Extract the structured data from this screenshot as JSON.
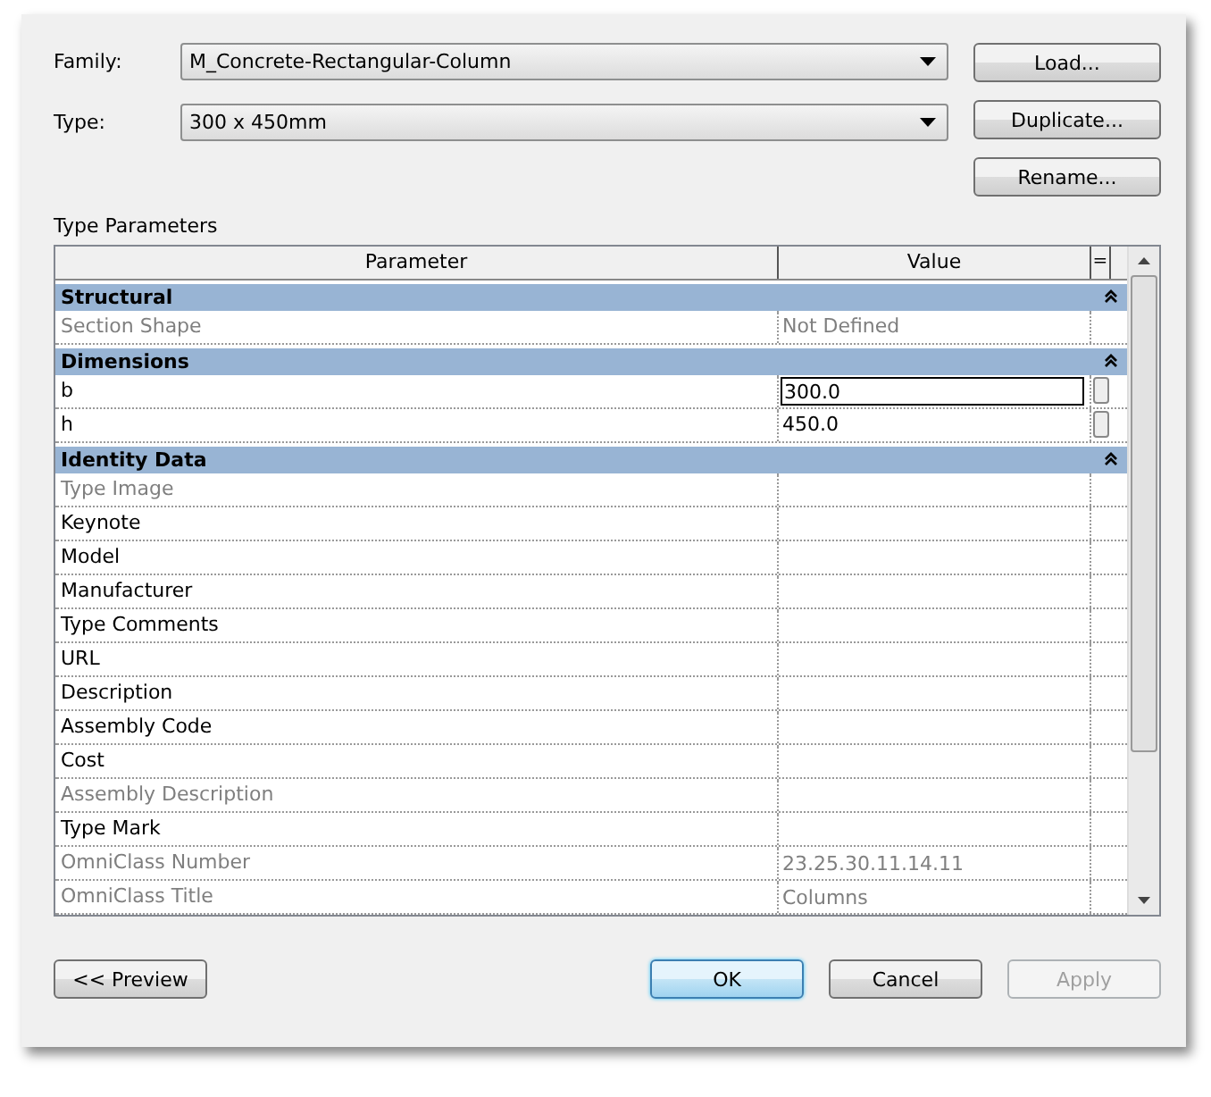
{
  "family": {
    "label": "Family:",
    "value": "M_Concrete-Rectangular-Column"
  },
  "type": {
    "label": "Type:",
    "value": "300 x 450mm"
  },
  "side_buttons": [
    "Load...",
    "Duplicate...",
    "Rename..."
  ],
  "section_title": "Type Parameters",
  "table": {
    "columns": [
      "Parameter",
      "Value",
      "="
    ],
    "groups": [
      {
        "name": "Structural",
        "expanded": true,
        "rows": [
          {
            "name": "Section Shape",
            "value": "Not Defined",
            "disabled": true,
            "editing": false,
            "spinner": false
          }
        ]
      },
      {
        "name": "Dimensions",
        "expanded": true,
        "rows": [
          {
            "name": "b",
            "value": "300.0",
            "disabled": false,
            "editing": true,
            "spinner": true
          },
          {
            "name": "h",
            "value": "450.0",
            "disabled": false,
            "editing": false,
            "spinner": true
          }
        ]
      },
      {
        "name": "Identity Data",
        "expanded": true,
        "rows": [
          {
            "name": "Type Image",
            "disabled": true,
            "editing": false,
            "spinner": false
          },
          {
            "name": "Keynote",
            "disabled": false,
            "editing": false,
            "spinner": false
          },
          {
            "name": "Model",
            "disabled": false,
            "editing": false,
            "spinner": false
          },
          {
            "name": "Manufacturer",
            "disabled": false,
            "editing": false,
            "spinner": false
          },
          {
            "name": "Type Comments",
            "disabled": false,
            "editing": false,
            "spinner": false
          },
          {
            "name": "URL",
            "disabled": false,
            "editing": false,
            "spinner": false
          },
          {
            "name": "Description",
            "disabled": false,
            "editing": false,
            "spinner": false
          },
          {
            "name": "Assembly Code",
            "disabled": false,
            "editing": false,
            "spinner": false
          },
          {
            "name": "Cost",
            "disabled": false,
            "editing": false,
            "spinner": false
          },
          {
            "name": "Assembly Description",
            "disabled": true,
            "editing": false,
            "spinner": false
          },
          {
            "name": "Type Mark",
            "disabled": false,
            "editing": false,
            "spinner": false
          },
          {
            "name": "OmniClass Number",
            "value": "23.25.30.11.14.11",
            "disabled": true,
            "editing": false,
            "spinner": false
          },
          {
            "name": "OmniClass Title",
            "value": "Columns",
            "disabled": true,
            "editing": false,
            "spinner": false
          }
        ]
      }
    ]
  },
  "bottom_buttons": [
    {
      "label": "<< Preview",
      "kind": "normal",
      "disabled": false
    },
    {
      "label": "OK",
      "kind": "default",
      "disabled": false
    },
    {
      "label": "Cancel",
      "kind": "normal",
      "disabled": false
    },
    {
      "label": "Apply",
      "kind": "normal",
      "disabled": true
    }
  ]
}
